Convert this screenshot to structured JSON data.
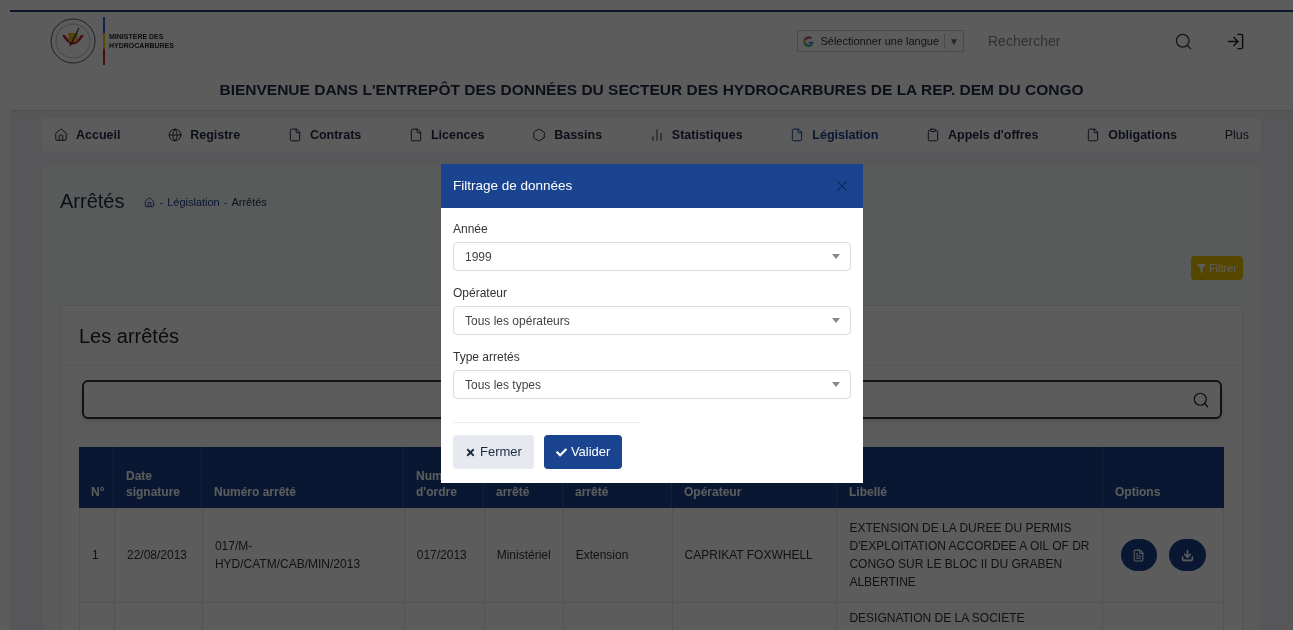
{
  "header": {
    "ministry": [
      "MINISTERE DES",
      "HYDROCARBURES"
    ],
    "language_selector": "Sélectionner une langue",
    "language_caret": "▼",
    "search": {
      "placeholder": "Rechercher"
    },
    "title": "BIENVENUE DANS L'ENTREPÔT DES DONNÉES DU SECTEUR DES HYDROCARBURES DE LA REP. DEM DU CONGO"
  },
  "nav": [
    {
      "label": "Accueil",
      "selected": false
    },
    {
      "label": "Registre",
      "selected": false
    },
    {
      "label": "Contrats",
      "selected": false
    },
    {
      "label": "Licences",
      "selected": false
    },
    {
      "label": "Bassins",
      "selected": false
    },
    {
      "label": "Statistiques",
      "selected": false
    },
    {
      "label": "Législation",
      "selected": true
    },
    {
      "label": "Appels d'offres",
      "selected": false
    },
    {
      "label": "Obligations",
      "selected": false
    },
    {
      "label": "Plus",
      "selected": false
    }
  ],
  "page": {
    "title": "Arrêtés",
    "breadcrumb": [
      "-",
      "Législation",
      "-",
      "Arrêtés"
    ],
    "filter_button": "Filtrer"
  },
  "card": {
    "title": "Les arrêtés"
  },
  "table": {
    "columns": [
      {
        "lines": [
          "N°"
        ]
      },
      {
        "lines": [
          "Date",
          "signature"
        ]
      },
      {
        "lines": [
          "Numéro arrêté"
        ]
      },
      {
        "lines": [
          "Num",
          "d'ordre"
        ]
      },
      {
        "lines": [
          "arrêté"
        ]
      },
      {
        "lines": [
          "arrêté"
        ]
      },
      {
        "lines": [
          "Opérateur"
        ]
      },
      {
        "lines": [
          "Libellé"
        ]
      },
      {
        "lines": [
          "Options"
        ]
      }
    ],
    "rows": [
      {
        "no": "1",
        "date": "22/08/2013",
        "numero": "017/M-HYD/CATM/CAB/MIN/2013",
        "ordre": "017/2013",
        "type": "Ministériel",
        "nature": "Extension",
        "operateur": "CAPRIKAT FOXWHELL",
        "libelle": "EXTENSION DE LA DUREE DU PERMIS D'EXPLOITATION ACCORDEE A OIL OF DR CONGO SUR LE BLOC II DU GRABEN ALBERTINE"
      },
      {
        "libelle": "DESIGNATION DE LA SOCIETE"
      }
    ]
  },
  "modal": {
    "title": "Filtrage de données",
    "fields": [
      {
        "label": "Année",
        "value": "1999"
      },
      {
        "label": "Opérateur",
        "value": "Tous les opérateurs"
      },
      {
        "label": "Type arretés",
        "value": "Tous les types"
      }
    ],
    "buttons": [
      {
        "kind": "close",
        "label": "Fermer"
      },
      {
        "kind": "submit",
        "label": "Valider"
      }
    ]
  }
}
